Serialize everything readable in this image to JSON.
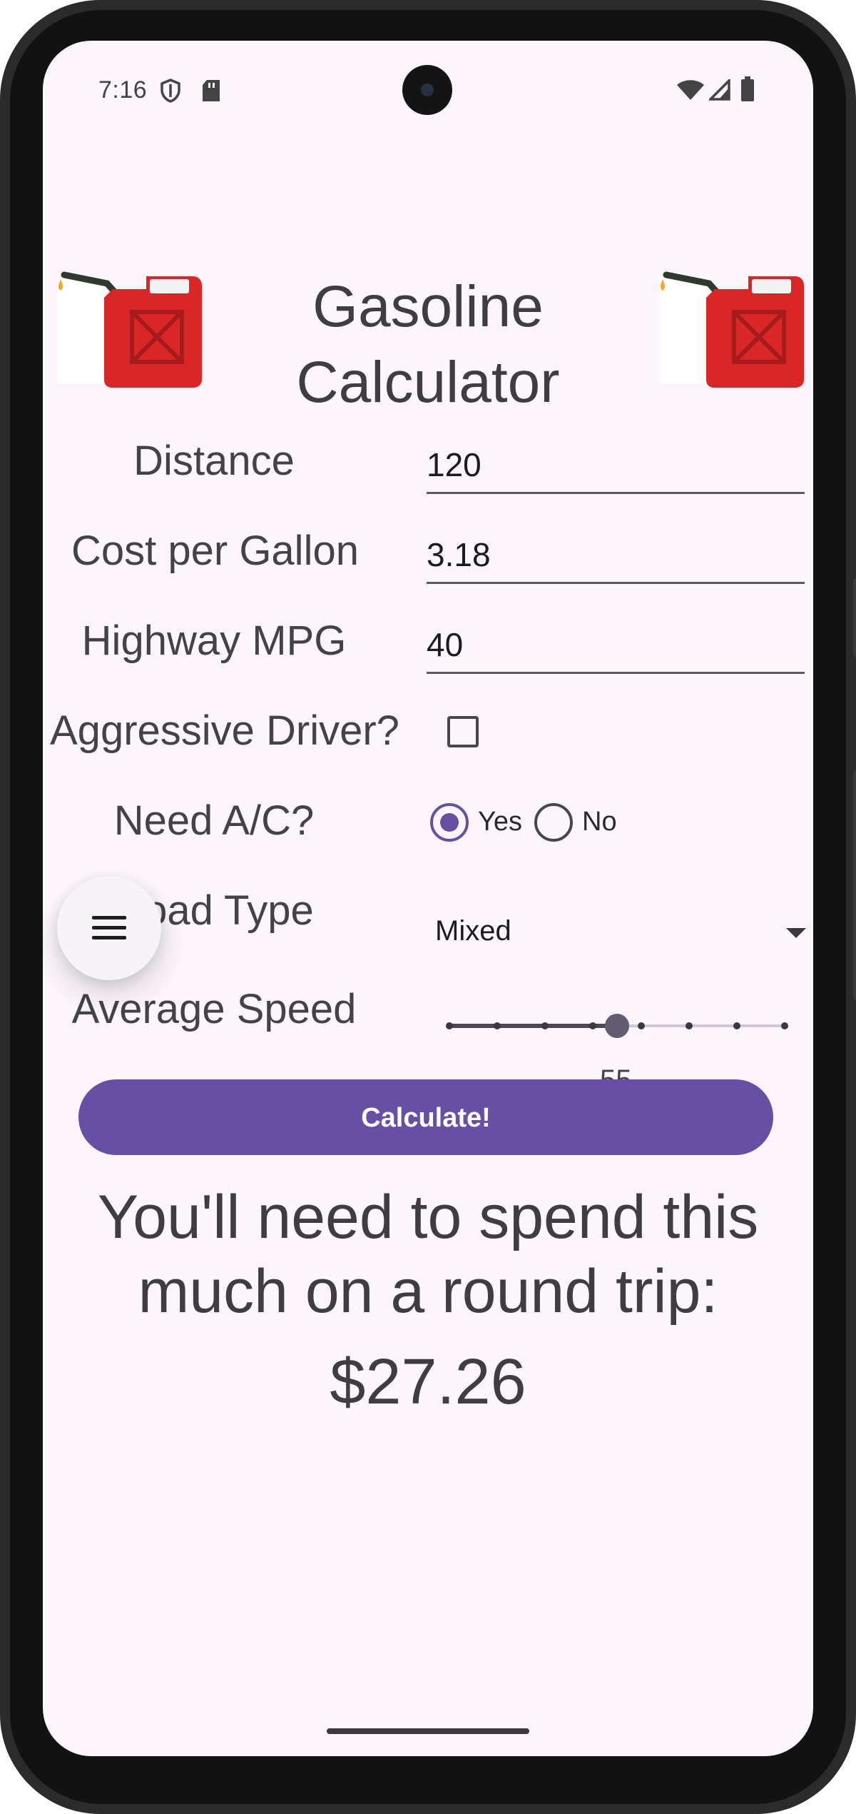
{
  "status_bar": {
    "time": "7:16",
    "icons": [
      "shield-icon",
      "sd-card-icon",
      "wifi-icon",
      "signal-icon",
      "battery-icon"
    ]
  },
  "header": {
    "title": "Gasoline Calculator",
    "icon": "gas-can-icon"
  },
  "form": {
    "distance": {
      "label": "Distance",
      "value": "120"
    },
    "cost_per_gallon": {
      "label": "Cost per Gallon",
      "value": "3.18"
    },
    "highway_mpg": {
      "label": "Highway MPG",
      "value": "40"
    },
    "aggressive_driver": {
      "label": "Aggressive Driver?",
      "checked": false
    },
    "need_ac": {
      "label": "Need A/C?",
      "options": [
        {
          "label": "Yes",
          "selected": true
        },
        {
          "label": "No",
          "selected": false
        }
      ]
    },
    "road_type": {
      "label": "Road Type",
      "value": "Mixed"
    },
    "average_speed": {
      "label": "Average Speed",
      "value": "55",
      "min": 20,
      "max": 90,
      "step": 10,
      "current": 55
    }
  },
  "actions": {
    "calculate_label": "Calculate!"
  },
  "result": {
    "message": "You'll need to spend this much on a round trip:",
    "amount": "$27.26"
  },
  "fab": {
    "icon": "menu-icon"
  },
  "colors": {
    "accent": "#674fa3",
    "background": "#fcf5fb",
    "text": "#3f3c42",
    "can_red": "#d92627"
  }
}
